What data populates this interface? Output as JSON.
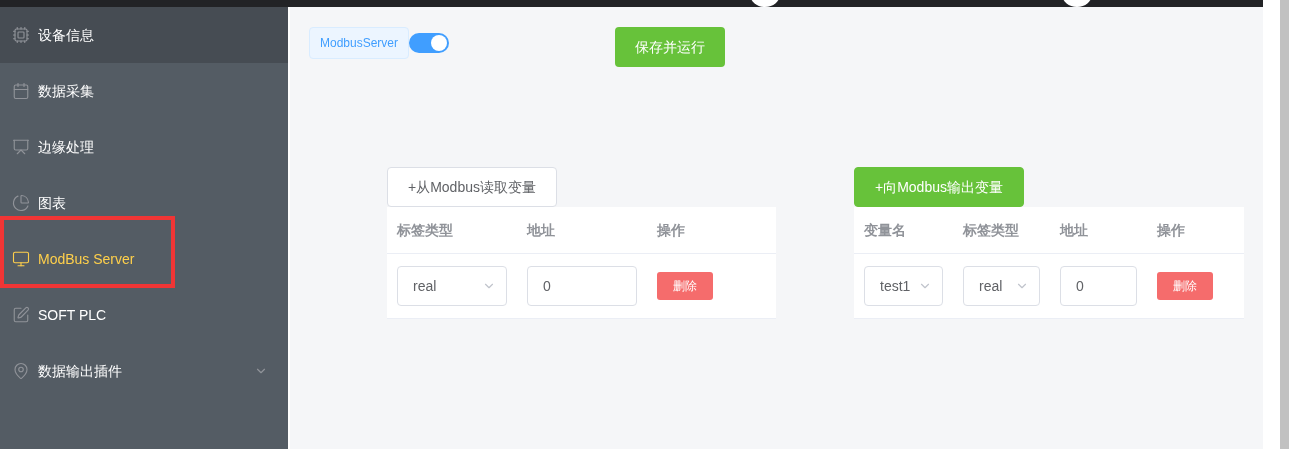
{
  "sidebar": {
    "items": [
      {
        "label": "设备信息",
        "selected": false,
        "hovered": true
      },
      {
        "label": "数据采集",
        "selected": false,
        "hovered": false
      },
      {
        "label": "边缘处理",
        "selected": false,
        "hovered": false
      },
      {
        "label": "图表",
        "selected": false,
        "hovered": false
      },
      {
        "label": "ModBus Server",
        "selected": true,
        "hovered": false,
        "highlighted": true
      },
      {
        "label": "SOFT PLC",
        "selected": false,
        "hovered": false
      },
      {
        "label": "数据输出插件",
        "selected": false,
        "hovered": false,
        "expandable": true
      }
    ]
  },
  "header": {
    "tag": "ModbusServer",
    "switch_on": true,
    "save_button": "保存并运行"
  },
  "read_section": {
    "button": "+从Modbus读取变量",
    "button_primary": false,
    "columns": [
      "标签类型",
      "地址",
      "操作"
    ],
    "rows": [
      {
        "cells": [
          {
            "kind": "select",
            "value": "real"
          },
          {
            "kind": "input",
            "value": "0"
          },
          {
            "kind": "delete",
            "value": "删除"
          }
        ]
      }
    ]
  },
  "write_section": {
    "button": "+向Modbus输出变量",
    "button_primary": true,
    "columns": [
      "变量名",
      "标签类型",
      "地址",
      "操作"
    ],
    "rows": [
      {
        "cells": [
          {
            "kind": "select",
            "value": "test1"
          },
          {
            "kind": "select",
            "value": "real"
          },
          {
            "kind": "input",
            "value": "0"
          },
          {
            "kind": "delete",
            "value": "删除"
          }
        ]
      }
    ]
  }
}
